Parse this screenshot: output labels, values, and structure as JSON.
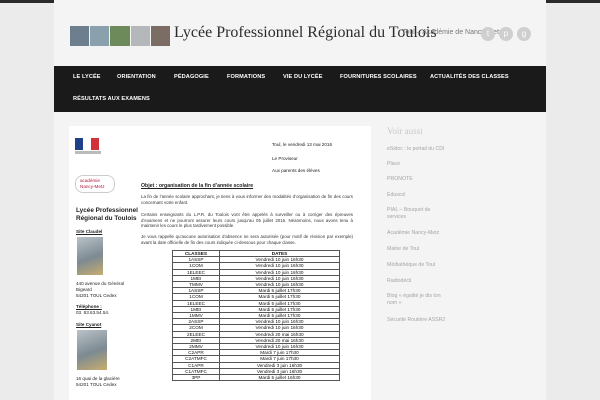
{
  "site": {
    "title": "Lycée Professionnel Régional du Toulois",
    "tagline": "Toul – Académie de Nancy-Metz",
    "social_icons": [
      "twitter-icon",
      "pinterest-icon",
      "gplus-icon"
    ],
    "header_photo_colors": [
      "#6d7f8f",
      "#8aa0ad",
      "#6c8a5a",
      "#b4b8ba",
      "#7b6d63"
    ]
  },
  "nav": {
    "row1": [
      "LE LYCÉE",
      "ORIENTATION",
      "PÉDAGOGIE",
      "FORMATIONS",
      "VIE DU LYCÉE",
      "FOURNITURES SCOLAIRES",
      "ACTUALITÉS DES CLASSES"
    ],
    "row2": [
      "RÉSULTATS AUX EXAMENS"
    ]
  },
  "letter": {
    "flag_colors": [
      "#1e3f8a",
      "#ffffff",
      "#d3313a"
    ],
    "academie_logo": "académie\nNancy-Metz",
    "date": "Toul, le vendredi 13 mai 2016",
    "from": "Le Proviseur",
    "to": "Aux parents des élèves",
    "school_name_1": "Lycée Professionnel",
    "school_name_2": "Régional du Toulois",
    "site1_title": "Site Claudel",
    "site1_address": [
      "440 avenue du Général",
      "Bigeard",
      "54201 TOUL Cedex"
    ],
    "phone_label": "Téléphone :",
    "phone": "03. 83.63.54.54.",
    "site2_title": "Site Cyanot",
    "site2_address": [
      "16 quai de la glacière",
      "54201 TOUL Cedex"
    ],
    "objet": "Objet : organisation de la fin d’année scolaire",
    "para1": "La fin de l’année scolaire approchant, je tiens à vous informer des modalités d’organisation de fin des cours concernant votre enfant.",
    "para2": "Certains enseignants du L.P.R. du Toulois vont être appelés à surveiller ou à corriger des épreuves d’examens et ne pourront assurer leurs cours jusqu’au 05 juillet 2016. Néanmoins, nous avons tenu à maintenir les cours le plus tardivement possible.",
    "para3": "Je vous rappelle qu’aucune autorisation d’absence ne sera autorisée (pour motif de révision par exemple) avant la date officielle de fin des cours indiquée ci-dessous pour chaque classe.",
    "table_headers": [
      "CLASSES",
      "DATES"
    ],
    "table_rows": [
      [
        "1ASSP",
        "Vendredi 10 juin 16h30"
      ],
      [
        "1COM",
        "Vendredi 10 juin 16h30"
      ],
      [
        "1ELEEC",
        "Vendredi 10 juin 16h30"
      ],
      [
        "1MEI",
        "Vendredi 10 juin 16h30"
      ],
      [
        "TMMV",
        "Vendredi 10 juin 16h30"
      ],
      [
        "1ASSP",
        "Mardi 5 juillet 17h30"
      ],
      [
        "1COM",
        "Mardi 5 juillet 17h30"
      ],
      [
        "1ELEEC",
        "Mardi 5 juillet 17h30"
      ],
      [
        "1MEI",
        "Mardi 5 juillet 17h30"
      ],
      [
        "1MMV",
        "Mardi 5 juillet 17h30"
      ],
      [
        "2ASSP",
        "Vendredi 10 juin 16h30"
      ],
      [
        "2COM",
        "Vendredi 10 juin 16h30"
      ],
      [
        "2ELEEC",
        "Vendredi 20 mai 16h30"
      ],
      [
        "2MEI",
        "Vendredi 20 mai 16h30"
      ],
      [
        "2MMV",
        "Vendredi 10 juin 16h30"
      ],
      [
        "C2APR",
        "Mardi 7 juin 17h30"
      ],
      [
        "C2ATMFC",
        "Mardi 7 juin 17h30"
      ],
      [
        "C1APR",
        "Vendredi 3 juin 16h30"
      ],
      [
        "C1ATMFC",
        "Vendredi 3 juin 16h30"
      ],
      [
        "3PP",
        "Mardi 5 juillet 16h30"
      ]
    ]
  },
  "sidebar": {
    "title": "Voir aussi",
    "links": [
      "eSidoc : le portail du CDI",
      "Place",
      "PRONOTE",
      "Eduscol",
      "PIAL – Bouquet de services",
      "Académie Nancy-Metz",
      "Mairie de Toul",
      "Médiathèque de Toul",
      "Radiodécli",
      "Blog « égalité je dis ton nom »",
      "Sécurité Routière ASSR2"
    ]
  }
}
